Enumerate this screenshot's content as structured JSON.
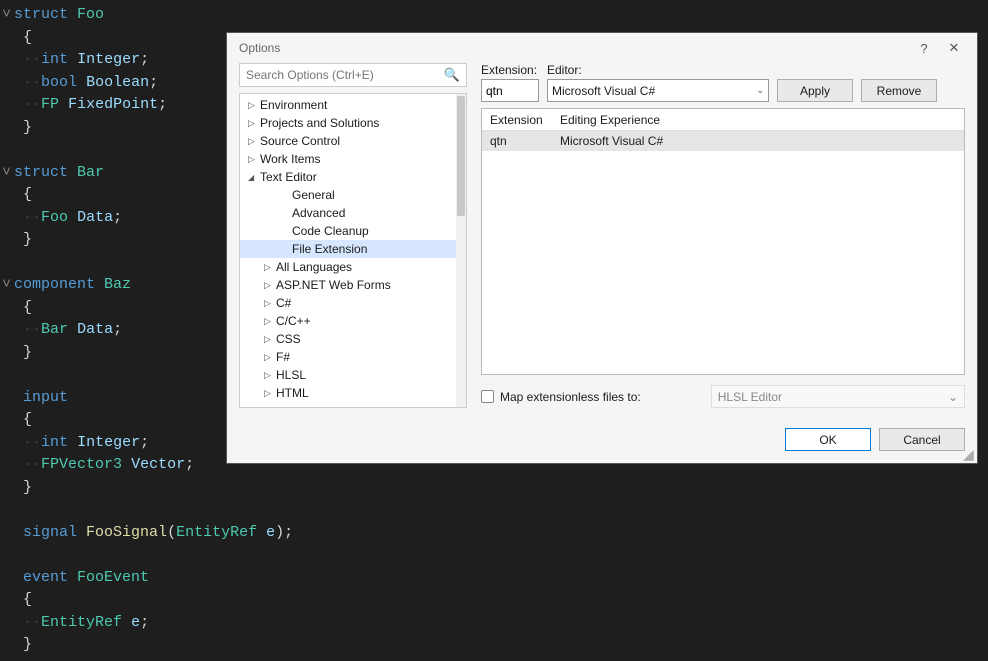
{
  "code": {
    "lines": [
      {
        "fold": "v",
        "tokens": [
          {
            "c": "kw",
            "t": "struct"
          },
          {
            "c": "pn",
            "t": " "
          },
          {
            "c": "typ",
            "t": "Foo"
          }
        ]
      },
      {
        "fold": " ",
        "tokens": [
          {
            "c": "pn",
            "t": " {"
          }
        ]
      },
      {
        "fold": " ",
        "tokens": [
          {
            "c": "pn",
            "t": " "
          },
          {
            "c": "dot",
            "t": "··"
          },
          {
            "c": "kw",
            "t": "int"
          },
          {
            "c": "pn",
            "t": " "
          },
          {
            "c": "var",
            "t": "Integer"
          },
          {
            "c": "pn",
            "t": ";"
          }
        ]
      },
      {
        "fold": " ",
        "tokens": [
          {
            "c": "pn",
            "t": " "
          },
          {
            "c": "dot",
            "t": "··"
          },
          {
            "c": "kw",
            "t": "bool"
          },
          {
            "c": "pn",
            "t": " "
          },
          {
            "c": "var",
            "t": "Boolean"
          },
          {
            "c": "pn",
            "t": ";"
          }
        ]
      },
      {
        "fold": " ",
        "tokens": [
          {
            "c": "pn",
            "t": " "
          },
          {
            "c": "dot",
            "t": "··"
          },
          {
            "c": "typ",
            "t": "FP"
          },
          {
            "c": "pn",
            "t": " "
          },
          {
            "c": "var",
            "t": "FixedPoint"
          },
          {
            "c": "pn",
            "t": ";"
          }
        ]
      },
      {
        "fold": " ",
        "tokens": [
          {
            "c": "pn",
            "t": " }"
          }
        ]
      },
      {
        "fold": " ",
        "tokens": [
          {
            "c": "pn",
            "t": ""
          }
        ]
      },
      {
        "fold": "v",
        "tokens": [
          {
            "c": "kw",
            "t": "struct"
          },
          {
            "c": "pn",
            "t": " "
          },
          {
            "c": "typ",
            "t": "Bar"
          }
        ]
      },
      {
        "fold": " ",
        "tokens": [
          {
            "c": "pn",
            "t": " {"
          }
        ]
      },
      {
        "fold": " ",
        "tokens": [
          {
            "c": "pn",
            "t": " "
          },
          {
            "c": "dot",
            "t": "··"
          },
          {
            "c": "typ",
            "t": "Foo"
          },
          {
            "c": "pn",
            "t": " "
          },
          {
            "c": "var",
            "t": "Data"
          },
          {
            "c": "pn",
            "t": ";"
          }
        ]
      },
      {
        "fold": " ",
        "tokens": [
          {
            "c": "pn",
            "t": " }"
          }
        ]
      },
      {
        "fold": " ",
        "tokens": [
          {
            "c": "pn",
            "t": ""
          }
        ]
      },
      {
        "fold": "v",
        "tokens": [
          {
            "c": "kw",
            "t": "component"
          },
          {
            "c": "pn",
            "t": " "
          },
          {
            "c": "typ",
            "t": "Baz"
          }
        ]
      },
      {
        "fold": " ",
        "tokens": [
          {
            "c": "pn",
            "t": " {"
          }
        ]
      },
      {
        "fold": " ",
        "tokens": [
          {
            "c": "pn",
            "t": " "
          },
          {
            "c": "dot",
            "t": "··"
          },
          {
            "c": "typ",
            "t": "Bar"
          },
          {
            "c": "pn",
            "t": " "
          },
          {
            "c": "var",
            "t": "Data"
          },
          {
            "c": "pn",
            "t": ";"
          }
        ]
      },
      {
        "fold": " ",
        "tokens": [
          {
            "c": "pn",
            "t": " }"
          }
        ]
      },
      {
        "fold": " ",
        "tokens": [
          {
            "c": "pn",
            "t": ""
          }
        ]
      },
      {
        "fold": " ",
        "tokens": [
          {
            "c": "pn",
            "t": " "
          },
          {
            "c": "kw",
            "t": "input"
          }
        ]
      },
      {
        "fold": " ",
        "tokens": [
          {
            "c": "pn",
            "t": " {"
          }
        ]
      },
      {
        "fold": " ",
        "tokens": [
          {
            "c": "pn",
            "t": " "
          },
          {
            "c": "dot",
            "t": "··"
          },
          {
            "c": "kw",
            "t": "int"
          },
          {
            "c": "pn",
            "t": " "
          },
          {
            "c": "var",
            "t": "Integer"
          },
          {
            "c": "pn",
            "t": ";"
          }
        ]
      },
      {
        "fold": " ",
        "tokens": [
          {
            "c": "pn",
            "t": " "
          },
          {
            "c": "dot",
            "t": "··"
          },
          {
            "c": "typ",
            "t": "FPVector3"
          },
          {
            "c": "pn",
            "t": " "
          },
          {
            "c": "var",
            "t": "Vector"
          },
          {
            "c": "pn",
            "t": ";"
          }
        ]
      },
      {
        "fold": " ",
        "tokens": [
          {
            "c": "pn",
            "t": " }"
          }
        ]
      },
      {
        "fold": " ",
        "tokens": [
          {
            "c": "pn",
            "t": ""
          }
        ]
      },
      {
        "fold": " ",
        "tokens": [
          {
            "c": "pn",
            "t": " "
          },
          {
            "c": "kw",
            "t": "signal"
          },
          {
            "c": "pn",
            "t": " "
          },
          {
            "c": "ident",
            "t": "FooSignal"
          },
          {
            "c": "pn",
            "t": "("
          },
          {
            "c": "typ",
            "t": "EntityRef"
          },
          {
            "c": "pn",
            "t": " "
          },
          {
            "c": "var",
            "t": "e"
          },
          {
            "c": "pn",
            "t": ");"
          }
        ]
      },
      {
        "fold": " ",
        "tokens": [
          {
            "c": "pn",
            "t": ""
          }
        ]
      },
      {
        "fold": " ",
        "tokens": [
          {
            "c": "pn",
            "t": " "
          },
          {
            "c": "kw",
            "t": "event"
          },
          {
            "c": "pn",
            "t": " "
          },
          {
            "c": "typ",
            "t": "FooEvent"
          }
        ]
      },
      {
        "fold": " ",
        "tokens": [
          {
            "c": "pn",
            "t": " {"
          }
        ]
      },
      {
        "fold": " ",
        "tokens": [
          {
            "c": "pn",
            "t": " "
          },
          {
            "c": "dot",
            "t": "··"
          },
          {
            "c": "typ",
            "t": "EntityRef"
          },
          {
            "c": "pn",
            "t": " "
          },
          {
            "c": "var",
            "t": "e"
          },
          {
            "c": "pn",
            "t": ";"
          }
        ]
      },
      {
        "fold": " ",
        "tokens": [
          {
            "c": "pn",
            "t": " }"
          }
        ]
      }
    ]
  },
  "dialog": {
    "title": "Options",
    "help": "?",
    "close": "✕",
    "search_placeholder": "Search Options (Ctrl+E)",
    "tree": [
      {
        "level": 0,
        "caret": "▹",
        "label": "Environment"
      },
      {
        "level": 0,
        "caret": "▹",
        "label": "Projects and Solutions"
      },
      {
        "level": 0,
        "caret": "▹",
        "label": "Source Control"
      },
      {
        "level": 0,
        "caret": "▹",
        "label": "Work Items"
      },
      {
        "level": 0,
        "caret": "▴",
        "label": "Text Editor"
      },
      {
        "level": 2,
        "caret": "",
        "label": "General"
      },
      {
        "level": 2,
        "caret": "",
        "label": "Advanced"
      },
      {
        "level": 2,
        "caret": "",
        "label": "Code Cleanup"
      },
      {
        "level": 2,
        "caret": "",
        "label": "File Extension",
        "selected": true
      },
      {
        "level": 1,
        "caret": "▹",
        "label": "All Languages"
      },
      {
        "level": 1,
        "caret": "▹",
        "label": "ASP.NET Web Forms"
      },
      {
        "level": 1,
        "caret": "▹",
        "label": "C#"
      },
      {
        "level": 1,
        "caret": "▹",
        "label": "C/C++"
      },
      {
        "level": 1,
        "caret": "▹",
        "label": "CSS"
      },
      {
        "level": 1,
        "caret": "▹",
        "label": "F#"
      },
      {
        "level": 1,
        "caret": "▹",
        "label": "HLSL"
      },
      {
        "level": 1,
        "caret": "▹",
        "label": "HTML"
      }
    ],
    "extension_label": "Extension:",
    "extension_value": "qtn",
    "editor_label": "Editor:",
    "editor_value": "Microsoft Visual C#",
    "apply_btn": "Apply",
    "remove_btn": "Remove",
    "grid": {
      "col_ext": "Extension",
      "col_editor": "Editing Experience",
      "rows": [
        {
          "ext": "qtn",
          "editor": "Microsoft Visual C#"
        }
      ]
    },
    "map_checkbox": "Map extensionless files to:",
    "map_value": "HLSL Editor",
    "ok_btn": "OK",
    "cancel_btn": "Cancel"
  }
}
